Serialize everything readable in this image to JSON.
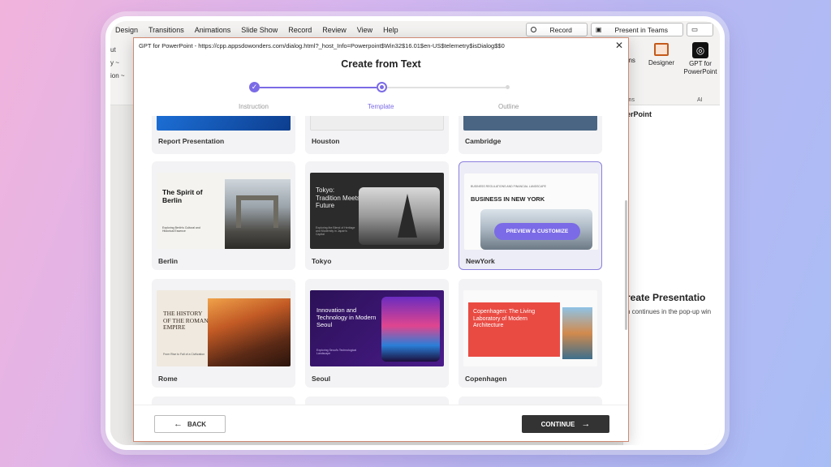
{
  "menu": [
    "Design",
    "Transitions",
    "Animations",
    "Slide Show",
    "Record",
    "Review",
    "View",
    "Help"
  ],
  "toolbar": {
    "record": "Record",
    "present_teams": "Present in Teams"
  },
  "ribbon": {
    "left_items": [
      "ut",
      "y ~",
      "ion ~"
    ],
    "addins_partial": "-ins",
    "addins_label": "ins",
    "designer": "Designer",
    "gpt_label": "GPT for PowerPoint",
    "ai_label": "AI"
  },
  "side_pane": {
    "title": "erPoint",
    "heading": "reate Presentatio",
    "note": "n continues in the pop-up win"
  },
  "dialog": {
    "window_title": "GPT for PowerPoint - https://cpp.appsdowonders.com/dialog.html?_host_Info=Powerpoint$Win32$16.01$en-US$telemetry$isDialog$$0",
    "title": "Create from Text",
    "steps": [
      "Instruction",
      "Template",
      "Outline"
    ],
    "back_label": "BACK",
    "continue_label": "CONTINUE"
  },
  "templates": [
    {
      "name": "Report Presentation"
    },
    {
      "name": "Houston"
    },
    {
      "name": "Cambridge"
    },
    {
      "name": "Berlin",
      "title": "The Spirit of Berlin",
      "sub": "Exploring Berlin's Cultural and Historical Essence"
    },
    {
      "name": "Tokyo",
      "title": "Tokyo: Tradition Meets Future",
      "sub": "Exploring the Blend of Heritage and Modernity in Japan's Capital"
    },
    {
      "name": "NewYork",
      "kicker": "BUSINESS REGULATIONS AND FINANCIAL LANDSCAPE",
      "title": "BUSINESS IN NEW YORK",
      "hover": "PREVIEW & CUSTOMIZE"
    },
    {
      "name": "Rome",
      "title": "THE HISTORY OF THE ROMAN EMPIRE",
      "sub": "From Rise to Fall of a Civilization"
    },
    {
      "name": "Seoul",
      "title": "Innovation and Technology in Modern Seoul",
      "sub": "Exploring Seoul's Technological Landscape"
    },
    {
      "name": "Copenhagen",
      "title": "Copenhagen: The Living Laboratory of Modern Architecture"
    }
  ],
  "colors": {
    "accent": "#7b6be6",
    "selected_border": "#8b80dc",
    "continue_bg": "#333333"
  }
}
